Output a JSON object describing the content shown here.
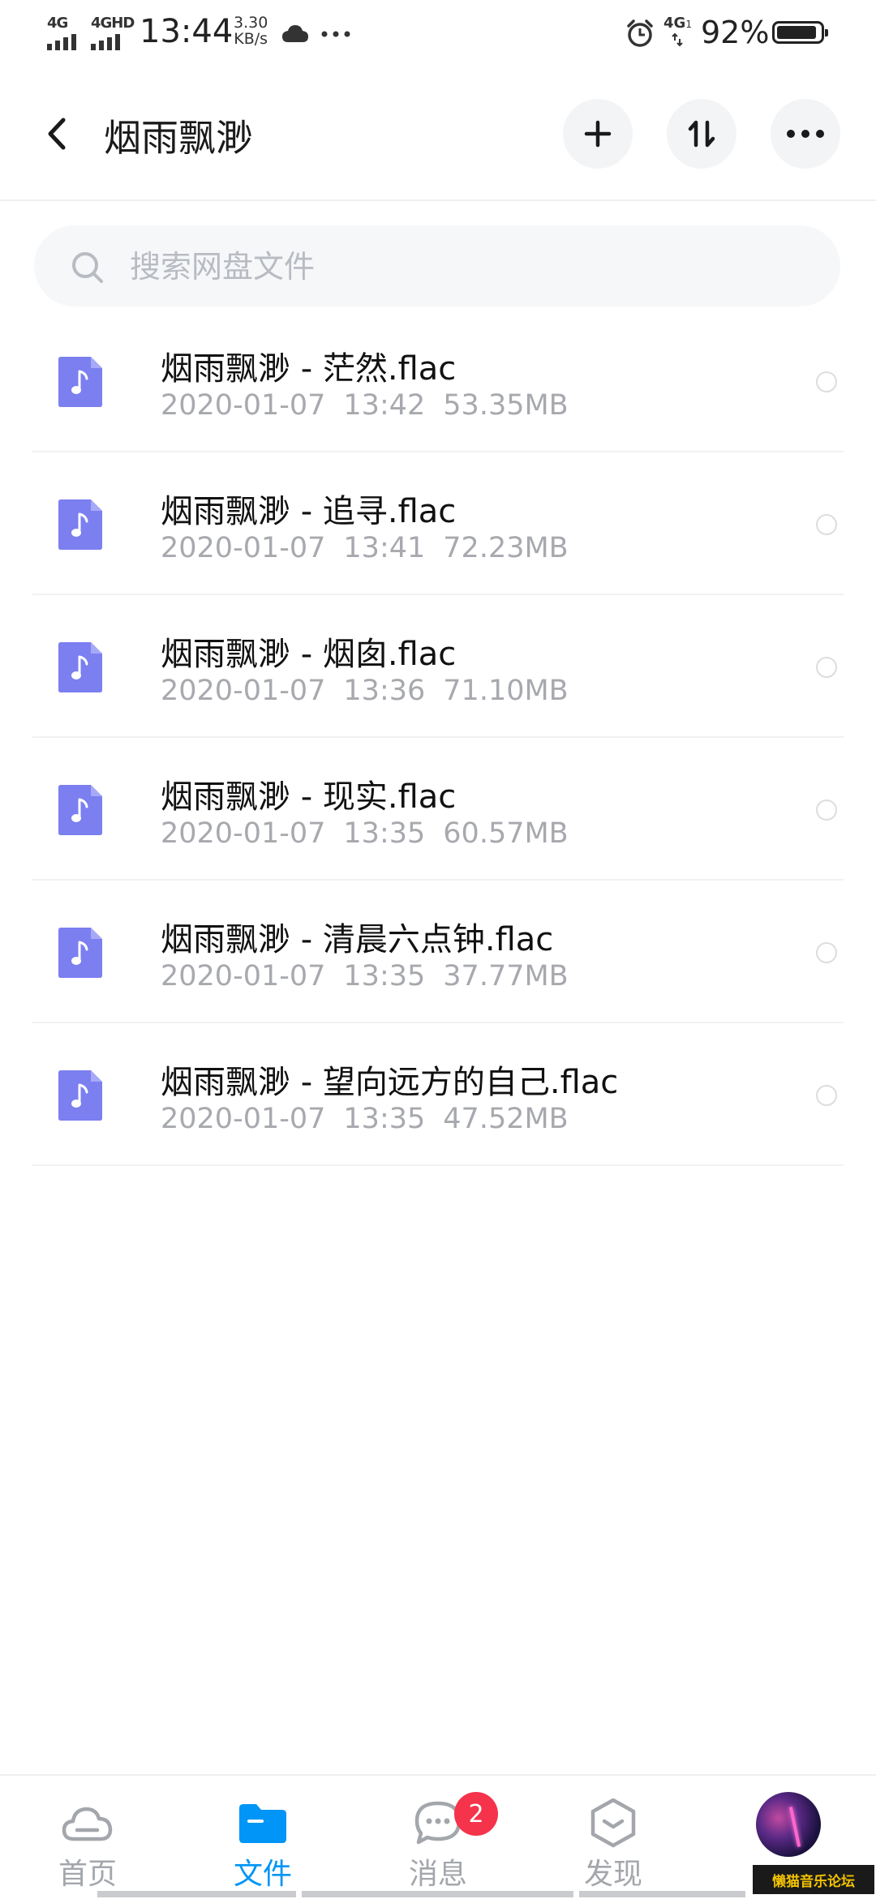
{
  "status_bar": {
    "network_1": "4G",
    "network_2": "4GHD",
    "time": "13:44",
    "speed_value": "3.30",
    "speed_unit": "KB/s",
    "network_3": "4G",
    "network_3_sub": "1",
    "battery_percent": "92%",
    "battery_level": 0.92
  },
  "header": {
    "title": "烟雨飘渺"
  },
  "search": {
    "placeholder": "搜索网盘文件"
  },
  "files": [
    {
      "name": "烟雨飘渺 - 茫然.flac",
      "date": "2020-01-07",
      "time": "13:42",
      "size": "53.35MB"
    },
    {
      "name": "烟雨飘渺 - 追寻.flac",
      "date": "2020-01-07",
      "time": "13:41",
      "size": "72.23MB"
    },
    {
      "name": "烟雨飘渺 - 烟囱.flac",
      "date": "2020-01-07",
      "time": "13:36",
      "size": "71.10MB"
    },
    {
      "name": "烟雨飘渺 - 现实.flac",
      "date": "2020-01-07",
      "time": "13:35",
      "size": "60.57MB"
    },
    {
      "name": "烟雨飘渺 - 清晨六点钟.flac",
      "date": "2020-01-07",
      "time": "13:35",
      "size": "37.77MB"
    },
    {
      "name": "烟雨飘渺 - 望向远方的自己.flac",
      "date": "2020-01-07",
      "time": "13:35",
      "size": "47.52MB"
    }
  ],
  "nav": {
    "items": [
      {
        "label": "首页",
        "icon": "cloud-icon",
        "active": false
      },
      {
        "label": "文件",
        "icon": "folder-icon",
        "active": true
      },
      {
        "label": "消息",
        "icon": "chat-icon",
        "active": false,
        "badge": "2"
      },
      {
        "label": "发现",
        "icon": "discover-icon",
        "active": false
      }
    ]
  },
  "watermark": "懒猫音乐论坛",
  "colors": {
    "accent": "#0095f6",
    "file_icon": "#7b7ff0",
    "badge": "#f5334b",
    "meta_text": "#a7a9ae"
  }
}
